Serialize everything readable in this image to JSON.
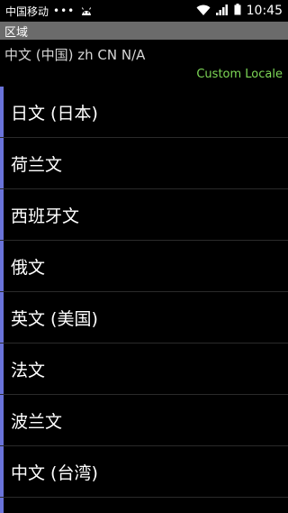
{
  "status": {
    "carrier": "中国移动",
    "dots": "•••",
    "time": "10:45"
  },
  "header": {
    "title": "区域"
  },
  "current": {
    "locale_text": "中文 (中国)  zh CN N/A",
    "custom_label": "Custom Locale"
  },
  "locales": [
    {
      "label": "日文 (日本)"
    },
    {
      "label": "荷兰文"
    },
    {
      "label": "西班牙文"
    },
    {
      "label": "俄文"
    },
    {
      "label": "英文 (美国)"
    },
    {
      "label": "法文"
    },
    {
      "label": "波兰文"
    },
    {
      "label": "中文 (台湾)"
    }
  ],
  "colors": {
    "title_bar": "#6b6b6b",
    "accent_green": "#7ed957",
    "scroll_indicator": "#6a73d9"
  },
  "icons": [
    "android-icon",
    "wifi-icon",
    "signal-icon",
    "battery-icon"
  ]
}
